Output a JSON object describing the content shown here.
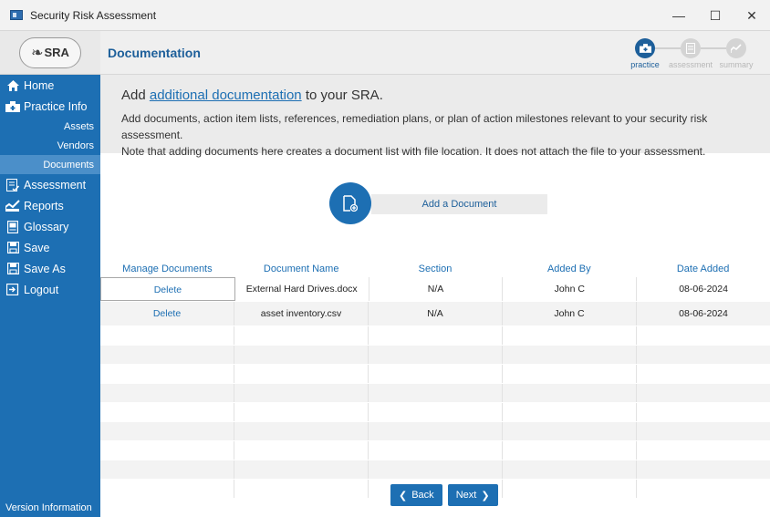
{
  "window": {
    "title": "Security Risk Assessment",
    "controls": {
      "minimize": "—",
      "maximize": "☐",
      "close": "✕"
    }
  },
  "sidebar": {
    "logo_text": "SRA",
    "items": [
      {
        "label": "Home",
        "icon": "home-icon"
      },
      {
        "label": "Practice Info",
        "icon": "practice-icon"
      },
      {
        "label": "Assets",
        "sub": true
      },
      {
        "label": "Vendors",
        "sub": true
      },
      {
        "label": "Documents",
        "sub": true,
        "active": true
      },
      {
        "label": "Assessment",
        "icon": "assessment-icon"
      },
      {
        "label": "Reports",
        "icon": "reports-icon"
      },
      {
        "label": "Glossary",
        "icon": "glossary-icon"
      },
      {
        "label": "Save",
        "icon": "save-icon"
      },
      {
        "label": "Save As",
        "icon": "save-as-icon"
      },
      {
        "label": "Logout",
        "icon": "logout-icon"
      }
    ],
    "version_label": "Version Information"
  },
  "header": {
    "title": "Documentation",
    "steps": [
      {
        "label": "practice",
        "state": "done"
      },
      {
        "label": "assessment",
        "state": "pending"
      },
      {
        "label": "summary",
        "state": "pending"
      }
    ]
  },
  "info": {
    "headline_prefix": "Add ",
    "headline_link": "additional documentation",
    "headline_suffix": " to your SRA.",
    "line1": "Add documents, action item lists, references, remediation plans, or plan of action milestones relevant to your security risk assessment.",
    "line2": "Note that adding documents here creates a document list with file location. It does not attach the file to your assessment."
  },
  "add_document": {
    "label": "Add a Document"
  },
  "table": {
    "headers": [
      "Manage Documents",
      "Document Name",
      "Section",
      "Added By",
      "Date Added"
    ],
    "rows": [
      [
        "Delete",
        "External Hard Drives.docx",
        "N/A",
        "John C",
        "08-06-2024"
      ],
      [
        "Delete",
        "asset inventory.csv",
        "N/A",
        "John C",
        "08-06-2024"
      ]
    ]
  },
  "footer": {
    "back_label": "Back",
    "next_label": "Next"
  },
  "colors": {
    "brand_blue": "#1d6fb3",
    "header_blue": "#1d5f9a"
  }
}
